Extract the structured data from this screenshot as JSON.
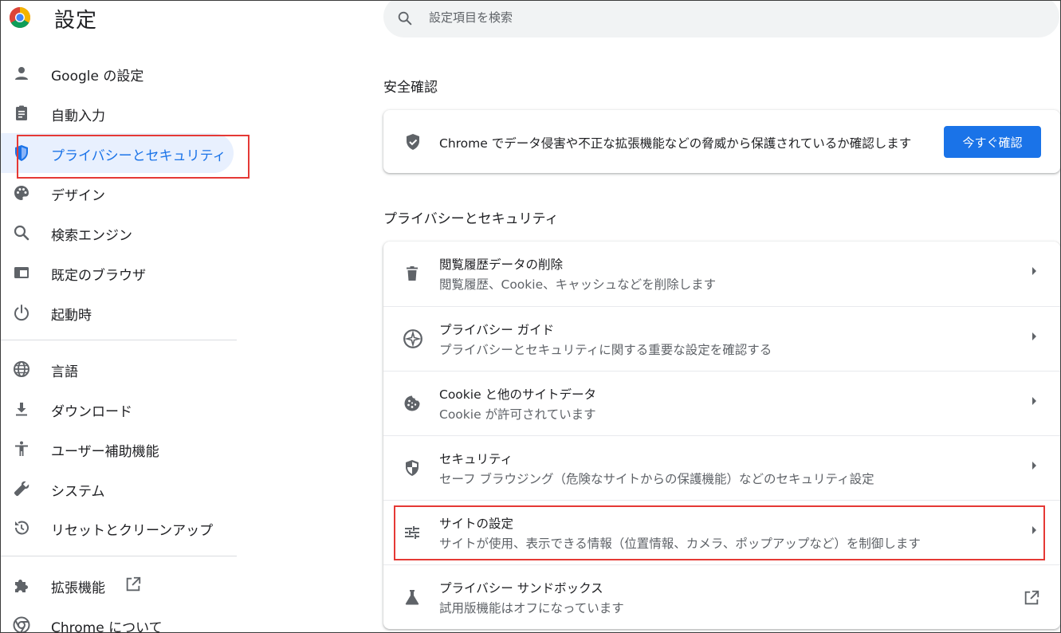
{
  "app": {
    "title": "設定"
  },
  "search": {
    "placeholder": "設定項目を検索"
  },
  "sidebar": {
    "items": [
      {
        "label": "Google の設定",
        "icon": "person-icon"
      },
      {
        "label": "自動入力",
        "icon": "clipboard-icon"
      },
      {
        "label": "プライバシーとセキュリティ",
        "icon": "shield-icon",
        "active": true
      },
      {
        "label": "デザイン",
        "icon": "palette-icon"
      },
      {
        "label": "検索エンジン",
        "icon": "search-icon"
      },
      {
        "label": "既定のブラウザ",
        "icon": "browser-icon"
      },
      {
        "label": "起動時",
        "icon": "power-icon"
      },
      {
        "label": "言語",
        "icon": "globe-icon"
      },
      {
        "label": "ダウンロード",
        "icon": "download-icon"
      },
      {
        "label": "ユーザー補助機能",
        "icon": "accessibility-icon"
      },
      {
        "label": "システム",
        "icon": "wrench-icon"
      },
      {
        "label": "リセットとクリーンアップ",
        "icon": "reset-icon"
      },
      {
        "label": "拡張機能",
        "icon": "puzzle-icon"
      },
      {
        "label": "Chrome について",
        "icon": "chrome-icon"
      }
    ]
  },
  "safety_check": {
    "heading": "安全確認",
    "text": "Chrome でデータ侵害や不正な拡張機能などの脅威から保護されているか確認します",
    "button": "今すぐ確認"
  },
  "privacy": {
    "heading": "プライバシーとセキュリティ",
    "rows": [
      {
        "title": "閲覧履歴データの削除",
        "subtitle": "閲覧履歴、Cookie、キャッシュなどを削除します",
        "icon": "trash-icon"
      },
      {
        "title": "プライバシー ガイド",
        "subtitle": "プライバシーとセキュリティに関する重要な設定を確認する",
        "icon": "compass-icon"
      },
      {
        "title": "Cookie と他のサイトデータ",
        "subtitle": "Cookie が許可されています",
        "icon": "cookie-icon"
      },
      {
        "title": "セキュリティ",
        "subtitle": "セーフ ブラウジング（危険なサイトからの保護機能）などのセキュリティ設定",
        "icon": "shield-icon"
      },
      {
        "title": "サイトの設定",
        "subtitle": "サイトが使用、表示できる情報（位置情報、カメラ、ポップアップなど）を制御します",
        "icon": "tune-icon"
      },
      {
        "title": "プライバシー サンドボックス",
        "subtitle": "試用版機能はオフになっています",
        "icon": "flask-icon"
      }
    ]
  },
  "colors": {
    "accent": "#1a73e8",
    "highlight": "#e53935",
    "active_bg": "#e8f0fe"
  }
}
